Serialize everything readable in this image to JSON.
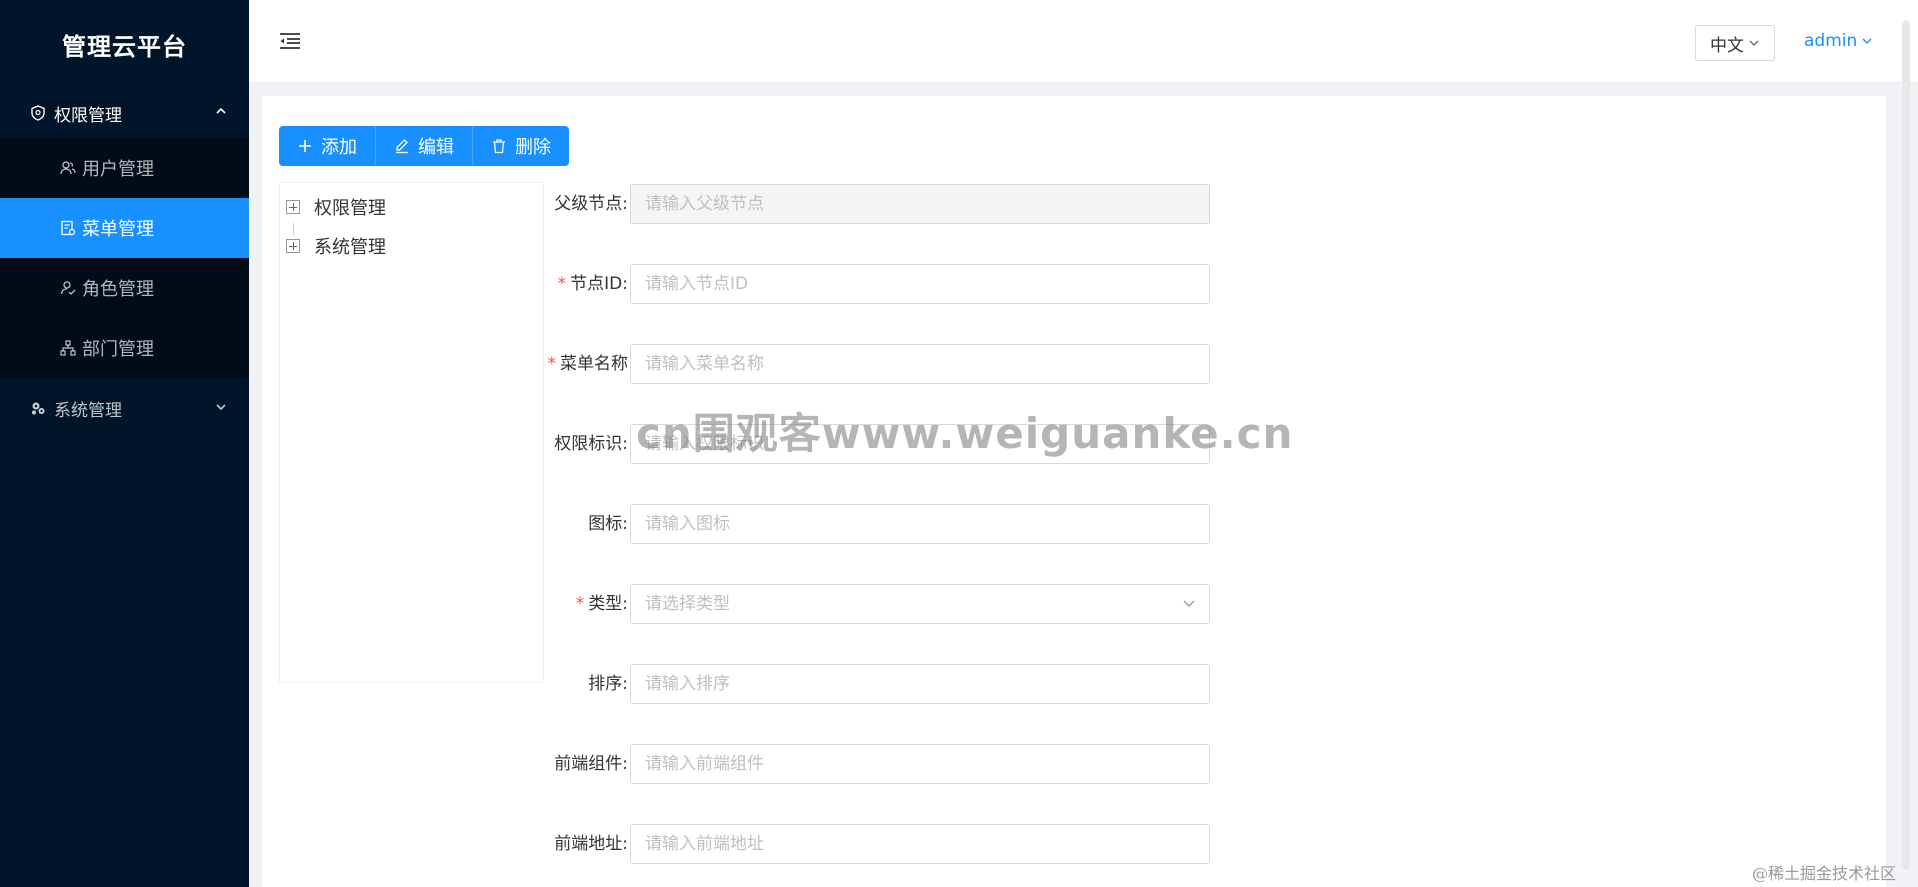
{
  "app": {
    "title": "管理云平台"
  },
  "sidebar": {
    "groups": [
      {
        "label": "权限管理",
        "icon": "shield-icon",
        "expanded": true,
        "items": [
          {
            "label": "用户管理",
            "icon": "user-icon",
            "active": false
          },
          {
            "label": "菜单管理",
            "icon": "menu-doc-icon",
            "active": true
          },
          {
            "label": "角色管理",
            "icon": "role-icon",
            "active": false
          },
          {
            "label": "部门管理",
            "icon": "org-icon",
            "active": false
          }
        ]
      },
      {
        "label": "系统管理",
        "icon": "settings-cluster-icon",
        "expanded": false
      }
    ]
  },
  "header": {
    "language": "中文",
    "user": "admin"
  },
  "toolbar": {
    "add_label": "添加",
    "edit_label": "编辑",
    "delete_label": "删除"
  },
  "tree": {
    "nodes": [
      {
        "label": "权限管理"
      },
      {
        "label": "系统管理"
      }
    ]
  },
  "form": {
    "fields": [
      {
        "label": "父级节点:",
        "placeholder": "请输入父级节点",
        "required": false,
        "disabled": true
      },
      {
        "label": "节点ID:",
        "placeholder": "请输入节点ID",
        "required": true
      },
      {
        "label": "菜单名称",
        "placeholder": "请输入菜单名称",
        "required": true
      },
      {
        "label": "权限标识:",
        "placeholder": "请输入权限标识",
        "required": false
      },
      {
        "label": "图标:",
        "placeholder": "请输入图标",
        "required": false
      },
      {
        "label": "类型:",
        "placeholder": "请选择类型",
        "required": true,
        "select": true
      },
      {
        "label": "排序:",
        "placeholder": "请输入排序",
        "required": false
      },
      {
        "label": "前端组件:",
        "placeholder": "请输入前端组件",
        "required": false
      },
      {
        "label": "前端地址:",
        "placeholder": "请输入前端地址",
        "required": false
      }
    ],
    "required_mark": "*"
  },
  "watermark": "cn围观客www.weiguanke.cn",
  "credit": "@稀土掘金技术社区",
  "colors": {
    "sidebar_bg": "#001529",
    "submenu_bg": "#000c17",
    "primary": "#1890ff",
    "required": "#ff4d4f"
  }
}
